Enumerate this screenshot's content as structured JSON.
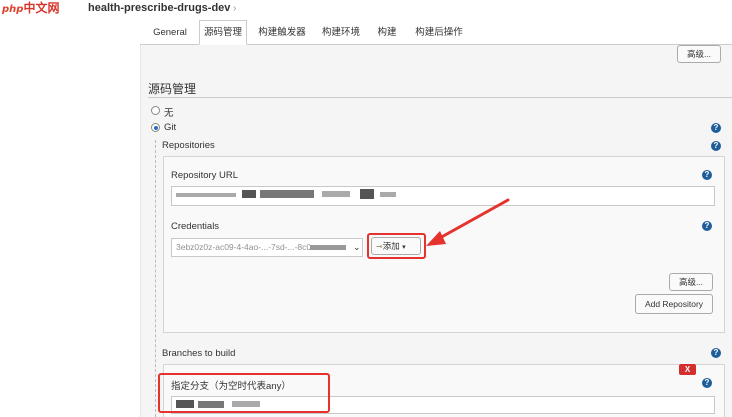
{
  "watermark": {
    "php": "php",
    "text": "中文网"
  },
  "breadcrumb": {
    "job_name": "health-prescribe-drugs-dev",
    "chevron": "›"
  },
  "tabs": [
    {
      "label": "General"
    },
    {
      "label": "源码管理",
      "active": true
    },
    {
      "label": "构建触发器"
    },
    {
      "label": "构建环境"
    },
    {
      "label": "构建"
    },
    {
      "label": "构建后操作"
    }
  ],
  "advanced_top": {
    "label": "高级..."
  },
  "scm": {
    "title": "源码管理",
    "options": [
      {
        "label": "无",
        "checked": false
      },
      {
        "label": "Git",
        "checked": true
      }
    ],
    "repositories_label": "Repositories",
    "repository_url_label": "Repository URL",
    "credentials_label": "Credentials",
    "credentials_value": "3ebz0z0z-ac09-4-4ao-...-7sd-...-8c0",
    "add_label": "添加",
    "advanced_label": "高级...",
    "add_repository_label": "Add Repository",
    "branches_label": "Branches to build",
    "branch_spec_label": "指定分支（为空时代表any）",
    "remove_label": "X",
    "help_mark": "?"
  },
  "colors": {
    "accent": "#1f5d99",
    "annotation_red": "#e5322d",
    "panel_bg": "#f5f5f5"
  },
  "icons": {
    "help": "question-circle-icon",
    "key": "key-icon",
    "caret": "caret-down-icon"
  }
}
